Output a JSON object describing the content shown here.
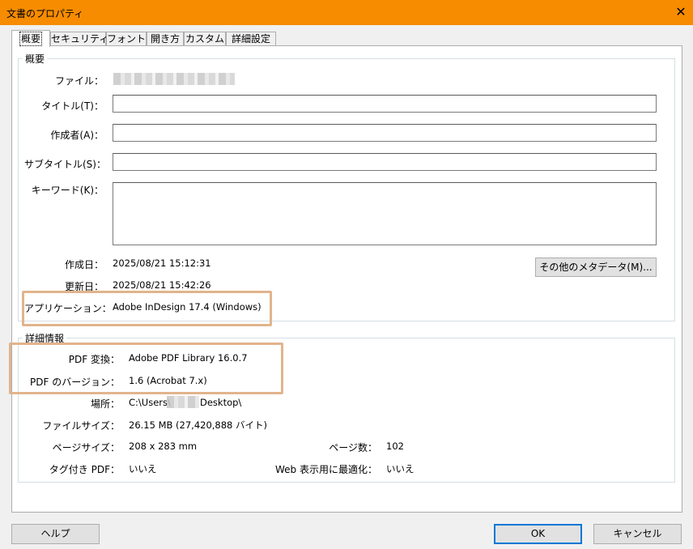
{
  "window": {
    "title": "文書のプロパティ",
    "close_glyph": "✕"
  },
  "tabs": [
    "概要",
    "セキュリティ",
    "フォント",
    "開き方",
    "カスタム",
    "詳細設定"
  ],
  "summary": {
    "group_title": "概要",
    "file_label": "ファイル：",
    "title_label": "タイトル(T)：",
    "author_label": "作成者(A)：",
    "subject_label": "サブタイトル(S)：",
    "keywords_label": "キーワード(K)：",
    "created_label": "作成日：",
    "created_value": "2025/08/21 15:12:31",
    "modified_label": "更新日：",
    "modified_value": "2025/08/21 15:42:26",
    "application_label": "アプリケーション：",
    "application_value": "Adobe InDesign 17.4 (Windows)",
    "more_metadata_button": "その他のメタデータ(M)..."
  },
  "details": {
    "group_title": "詳細情報",
    "pdf_producer_label": "PDF 変換：",
    "pdf_producer_value": "Adobe PDF Library 16.0.7",
    "pdf_version_label": "PDF のバージョン：",
    "pdf_version_value": "1.6 (Acrobat 7.x)",
    "location_label": "場所：",
    "location_value_start": "C:\\Users\\",
    "location_value_end": "Desktop\\",
    "file_size_label": "ファイルサイズ：",
    "file_size_value": "26.15 MB (27,420,888 バイト)",
    "page_size_label": "ページサイズ：",
    "page_size_value": "208 x 283 mm",
    "page_count_label": "ページ数：",
    "page_count_value": "102",
    "tagged_label": "タグ付き PDF：",
    "tagged_value": "いいえ",
    "fast_web_label": "Web 表示用に最適化：",
    "fast_web_value": "いいえ"
  },
  "buttons": {
    "help": "ヘルプ",
    "ok": "OK",
    "cancel": "キャンセル"
  },
  "colors": {
    "titlebar": "#f78c00",
    "highlight": "#e1b48c",
    "ok_border": "#0078d7"
  }
}
